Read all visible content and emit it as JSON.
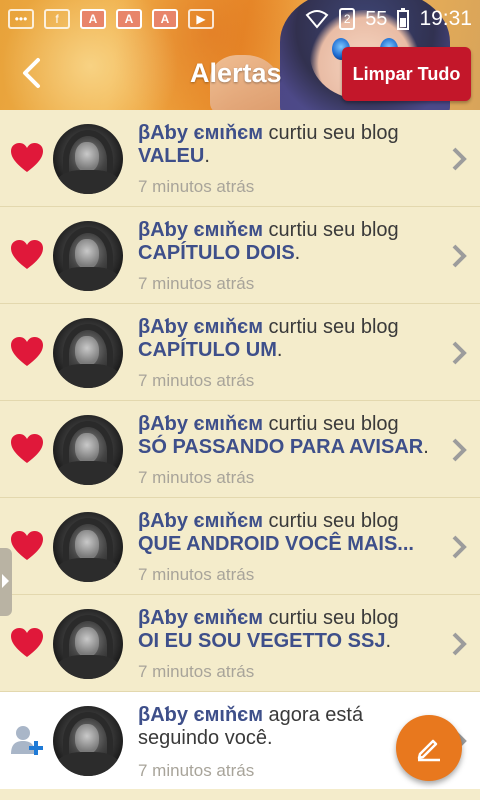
{
  "status_bar": {
    "app_icons": [
      "notification-icon",
      "facebook-icon",
      "amino-icon",
      "amino-icon",
      "amino-icon",
      "youtube-icon"
    ],
    "sim_label": "2",
    "battery": "55",
    "time": "19:31"
  },
  "header": {
    "title": "Alertas",
    "clear_label": "Limpar Tudo"
  },
  "notifications": [
    {
      "user": "βΑƅу ємιňєм",
      "action": " curtiu seu blog",
      "blog": "VALEU",
      "suffix": ".",
      "time": "7 minutos atrás",
      "icon": "heart-icon"
    },
    {
      "user": "βΑƅу ємιňєм",
      "action": " curtiu seu blog",
      "blog": "CAPÍTULO DOIS",
      "suffix": ".",
      "time": "7 minutos atrás",
      "icon": "heart-icon"
    },
    {
      "user": "βΑƅу ємιňєм",
      "action": " curtiu seu blog",
      "blog": "CAPÍTULO UM",
      "suffix": ".",
      "time": "7 minutos atrás",
      "icon": "heart-icon"
    },
    {
      "user": "βΑƅу ємιňєм",
      "action": " curtiu seu blog",
      "blog": "SÓ PASSANDO PARA AVISAR",
      "suffix": ".",
      "time": "7 minutos atrás",
      "icon": "heart-icon"
    },
    {
      "user": "βΑƅу ємιňєм",
      "action": " curtiu seu blog",
      "blog": "QUE ANDROID VOCÊ MAIS...",
      "suffix": "",
      "time": "7 minutos atrás",
      "icon": "heart-icon"
    },
    {
      "user": "βΑƅу ємιňєм",
      "action": " curtiu seu blog",
      "blog": "OI EU SOU VEGETTO SSJ",
      "suffix": ".",
      "time": "7 minutos atrás",
      "icon": "heart-icon"
    },
    {
      "user": "βΑƅу ємιňєм",
      "action": " agora está seguindo você.",
      "blog": "",
      "suffix": "",
      "time": "7 minutos atrás",
      "icon": "follow-user-icon"
    }
  ],
  "colors": {
    "accent": "#c3172a",
    "fab": "#e8781e",
    "heart": "#e0183a",
    "link": "#3e4f8a",
    "row_bg": "#f4eccb"
  }
}
